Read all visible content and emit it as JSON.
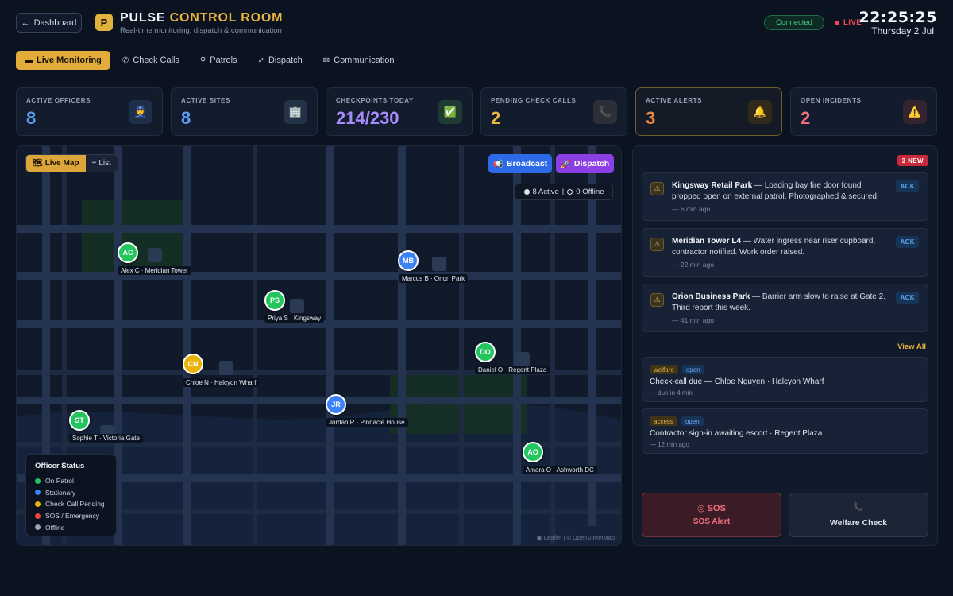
{
  "header": {
    "back_label": "Dashboard",
    "logo_letter": "P",
    "title_main": "PULSE",
    "title_accent": "CONTROL ROOM",
    "subtitle": "Real-time monitoring, dispatch & communication",
    "connection": "Connected",
    "live": "LIVE",
    "time": "22:25:25",
    "date": "Thursday 2 Jul"
  },
  "tabs": [
    {
      "icon": "▬",
      "label": "Live Monitoring",
      "active": true
    },
    {
      "icon": "✆",
      "label": "Check Calls",
      "active": false
    },
    {
      "icon": "⚲",
      "label": "Patrols",
      "active": false
    },
    {
      "icon": "➶",
      "label": "Dispatch",
      "active": false
    },
    {
      "icon": "✉",
      "label": "Communication",
      "active": false
    }
  ],
  "stats": [
    {
      "label": "ACTIVE OFFICERS",
      "value": "8",
      "color": "#5b9cf5",
      "icon": "👮",
      "icon_bg": "#1e2f4a"
    },
    {
      "label": "ACTIVE SITES",
      "value": "8",
      "color": "#5b9cf5",
      "icon": "🏢",
      "icon_bg": "#243247"
    },
    {
      "label": "CHECKPOINTS TODAY",
      "value": "214/230",
      "color": "#a78bfa",
      "icon": "✅",
      "icon_bg": "#1d3a33"
    },
    {
      "label": "PENDING CHECK CALLS",
      "value": "2",
      "color": "#e9b440",
      "icon": "📞",
      "icon_bg": "#2a2f38"
    },
    {
      "label": "ACTIVE ALERTS",
      "value": "3",
      "color": "#f08a3a",
      "icon": "🔔",
      "icon_bg": "#33291b"
    },
    {
      "label": "OPEN INCIDENTS",
      "value": "2",
      "color": "#f0707c",
      "icon": "⚠️",
      "icon_bg": "#352330"
    }
  ],
  "map": {
    "view_live": "Live Map",
    "view_list": "List",
    "broadcast": "Broadcast",
    "dispatch": "Dispatch",
    "active_count": "8 Active",
    "offline_count": "0 Offline",
    "attribution": "Leaflet | © OpenStreetMap",
    "officers": [
      {
        "initials": "AC",
        "label": "Alex C · Meridian Tower",
        "color": "#22c55e"
      },
      {
        "initials": "MB",
        "label": "Marcus B · Orion Park",
        "color": "#3b82f6"
      },
      {
        "initials": "PS",
        "label": "Priya S · Kingsway",
        "color": "#22c55e"
      },
      {
        "initials": "CN",
        "label": "Chloe N · Halcyon Wharf",
        "color": "#eab308"
      },
      {
        "initials": "DO",
        "label": "Daniel O · Regent Plaza",
        "color": "#22c55e"
      },
      {
        "initials": "JR",
        "label": "Jordan R · Pinnacle House",
        "color": "#3b82f6"
      },
      {
        "initials": "ST",
        "label": "Sophie T · Victoria Gate",
        "color": "#22c55e"
      },
      {
        "initials": "AO",
        "label": "Amara O · Ashworth DC",
        "color": "#22c55e"
      }
    ],
    "legend": {
      "title": "Officer Status",
      "items": [
        {
          "label": "On Patrol",
          "color": "#22c55e"
        },
        {
          "label": "Stationary",
          "color": "#3b82f6"
        },
        {
          "label": "Check Call Pending",
          "color": "#eab308"
        },
        {
          "label": "SOS / Emergency",
          "color": "#ef4444"
        },
        {
          "label": "Offline",
          "color": "#9ca3af"
        }
      ]
    }
  },
  "alerts": {
    "new_badge": "3 NEW",
    "ack_label": "ACK",
    "items": [
      {
        "site": "Kingsway Retail Park",
        "text": " — Loading bay fire door found propped open on external patrol. Photographed & secured.",
        "time": "— 6 min ago"
      },
      {
        "site": "Meridian Tower L4",
        "text": " — Water ingress near riser cupboard, contractor notified. Work order raised.",
        "time": "— 22 min ago"
      },
      {
        "site": "Orion Business Park",
        "text": " — Barrier arm slow to raise at Gate 2. Third report this week.",
        "time": "— 41 min ago"
      }
    ],
    "view_all": "View All"
  },
  "tasks": [
    {
      "tag": "welfare",
      "status": "open",
      "title": "Check-call due — Chloe Nguyen · Halcyon Wharf",
      "time": "— due in 4 min"
    },
    {
      "tag": "access",
      "status": "open",
      "title": "Contractor sign-in awaiting escort · Regent Plaza",
      "time": "— 12 min ago"
    }
  ],
  "actions": {
    "sos_top": "SOS",
    "sos_label": "SOS Alert",
    "welfare_label": "Welfare Check"
  }
}
